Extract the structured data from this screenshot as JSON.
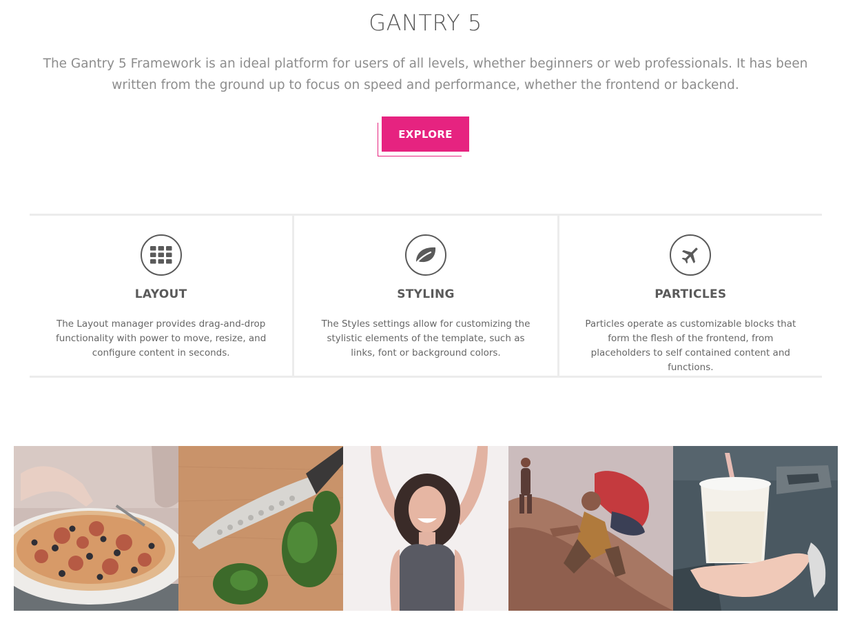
{
  "hero": {
    "title": "GANTRY 5",
    "description": "The Gantry 5 Framework is an ideal platform for users of all levels, whether beginners or web professionals. It has been written from the ground up to focus on speed and performance, whether the frontend or backend.",
    "button_label": "EXPLORE"
  },
  "features": [
    {
      "icon": "grid-icon",
      "title": "LAYOUT",
      "description": "The Layout manager provides drag-and-drop functionality with power to move, resize, and configure content in seconds."
    },
    {
      "icon": "leaf-icon",
      "title": "STYLING",
      "description": "The Styles settings allow for customizing the stylistic elements of the template, such as links, font or background colors."
    },
    {
      "icon": "plane-icon",
      "title": "PARTICLES",
      "description": "Particles operate as customizable blocks that form the flesh of the frontend, from placeholders to self contained content and functions."
    }
  ],
  "gallery": [
    {
      "subject": "pizza"
    },
    {
      "subject": "knife-and-herbs"
    },
    {
      "subject": "laughing-woman"
    },
    {
      "subject": "hikers-on-rock"
    },
    {
      "subject": "drink-in-car"
    }
  ],
  "colors": {
    "accent": "#e62380",
    "text": "#5a5a5a",
    "muted": "#8d8d8d",
    "divider": "#ececec"
  }
}
